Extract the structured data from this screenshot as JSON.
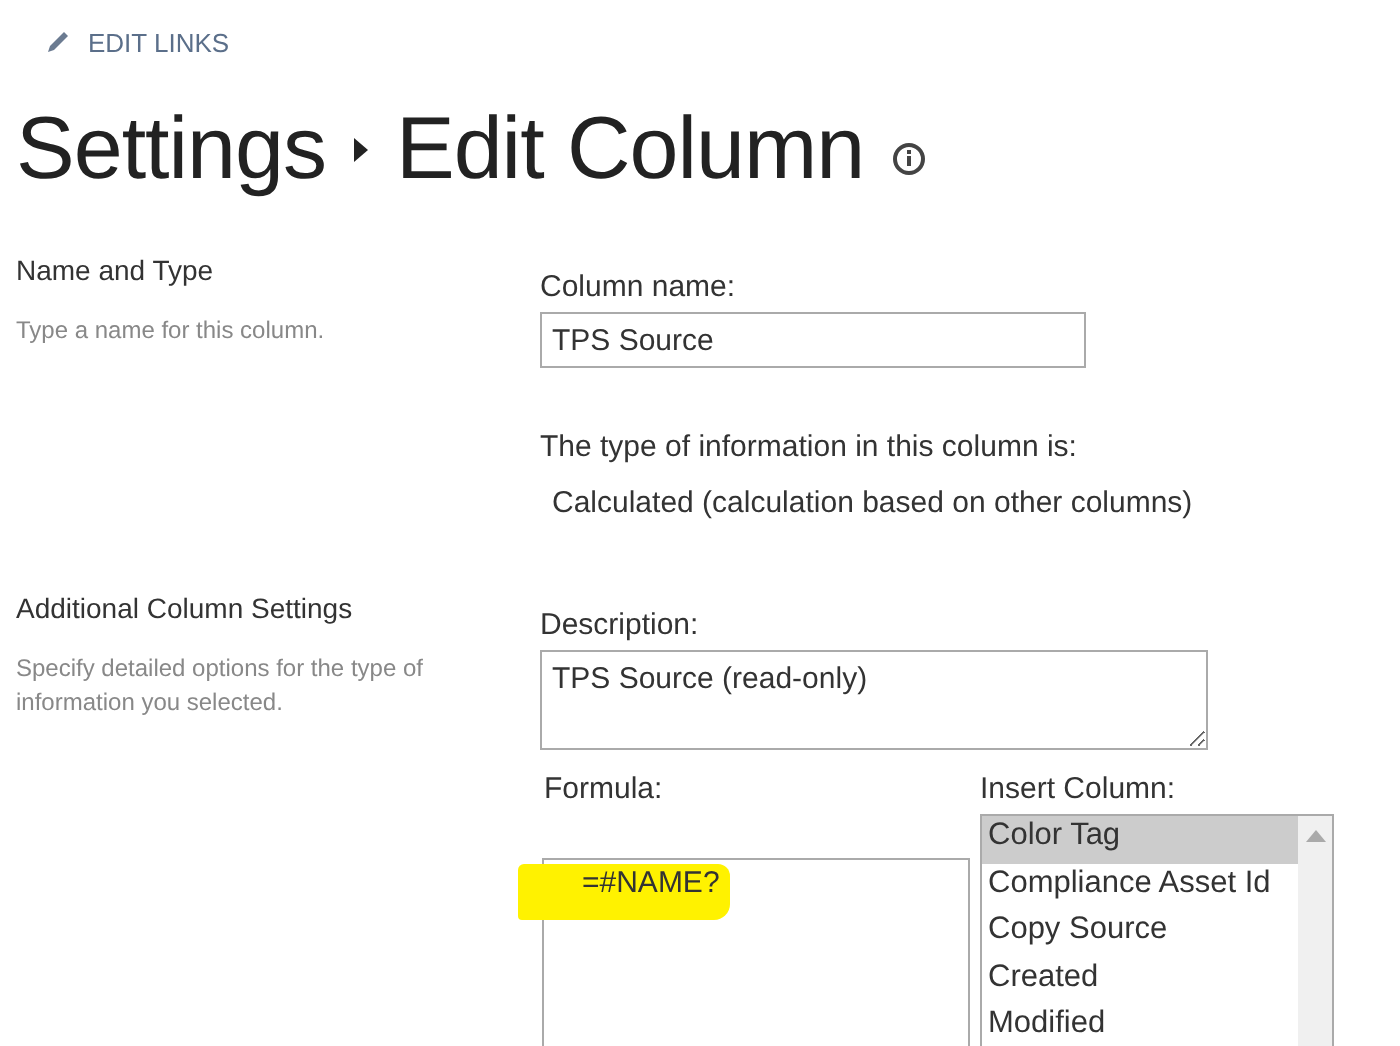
{
  "edit_links": {
    "label": "EDIT LINKS"
  },
  "breadcrumb": [
    "Settings",
    "Edit Column"
  ],
  "sections": [
    {
      "title": "Name and Type",
      "description": "Type a name for this column.",
      "kind": "name"
    },
    {
      "title": "Additional Column Settings",
      "description": "Specify detailed options for the type of information you selected.",
      "kind": "settings"
    }
  ],
  "column_name": {
    "label": "Column name:",
    "value": "TPS Source"
  },
  "type_info": {
    "label": "The type of information in this column is:",
    "value": "Calculated (calculation based on other columns)"
  },
  "description": {
    "label": "Description:",
    "value": "TPS Source (read-only)"
  },
  "formula": {
    "label": "Formula:",
    "value": "=#NAME?",
    "highlighted": true
  },
  "insert_column": {
    "label": "Insert Column:",
    "items": [
      {
        "label": "Color Tag",
        "selected": true
      },
      {
        "label": "Compliance Asset Id",
        "selected": false
      },
      {
        "label": "Copy Source",
        "selected": false
      },
      {
        "label": "Created",
        "selected": false
      },
      {
        "label": "Modified",
        "selected": false
      }
    ]
  }
}
